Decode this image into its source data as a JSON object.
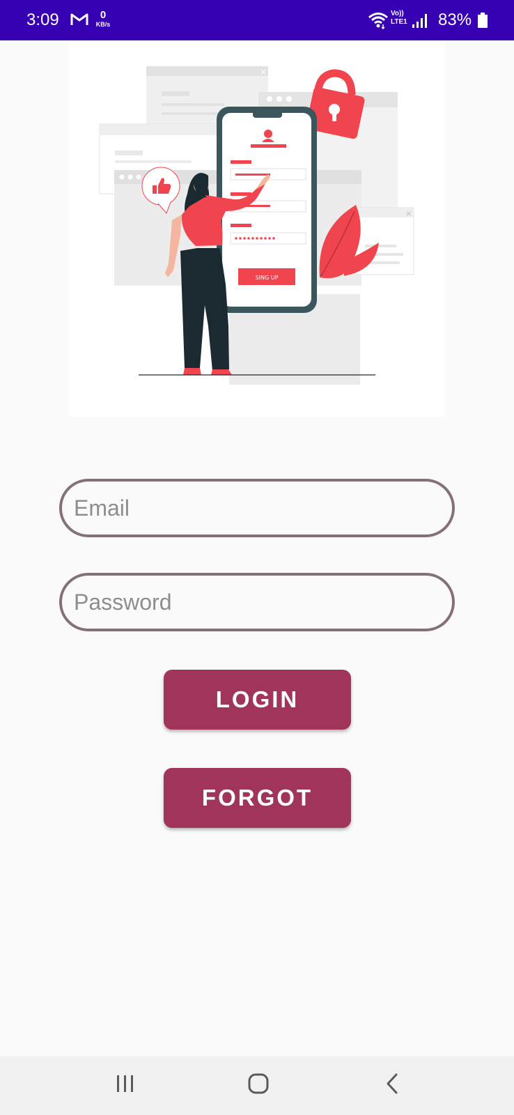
{
  "status_bar": {
    "time": "3:09",
    "speed_value": "0",
    "speed_unit": "KB/s",
    "volte_top": "Vo))",
    "volte_bottom": "LTE1",
    "battery": "83%",
    "icons": [
      "gmail-icon",
      "wifi-icon",
      "signal-icon",
      "battery-icon"
    ]
  },
  "illustration": {
    "phone_button": "SING UP",
    "colors": {
      "accent": "#f0454f",
      "phone_frame": "#3a555b",
      "figure_dark": "#1b2a30"
    }
  },
  "form": {
    "email_placeholder": "Email",
    "password_placeholder": "Password"
  },
  "buttons": {
    "login_label": "LOGIN",
    "forgot_label": "FORGOT"
  },
  "nav_bar": {
    "icons": [
      "recent-apps-icon",
      "home-icon",
      "back-icon"
    ]
  },
  "theme": {
    "status_bar_color": "#3700b3",
    "button_color": "#a1345a",
    "field_border_color": "#84707a",
    "background": "#fafafa"
  }
}
